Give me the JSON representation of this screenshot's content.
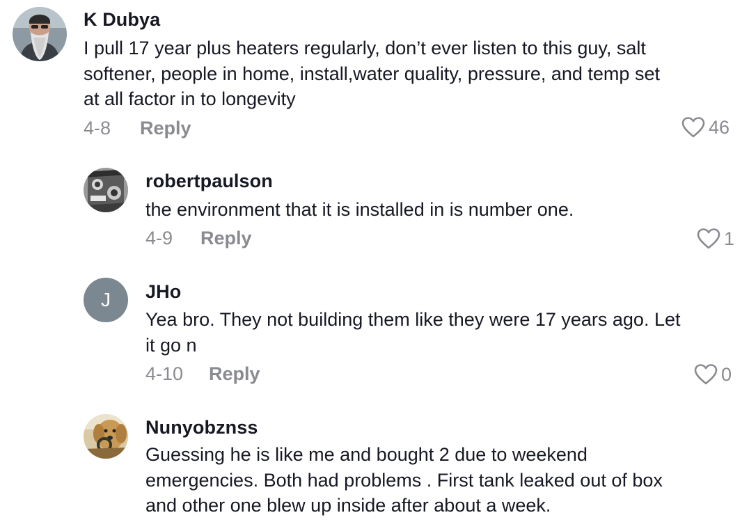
{
  "comments": [
    {
      "username": "K Dubya",
      "avatar": "photo-bearded-man",
      "text_lines": [
        "I pull 17 year plus heaters regularly, don’t ever listen to this guy, salt",
        "softener, people in home, install,water quality, pressure, and temp set",
        "at all factor in to longevity"
      ],
      "date": "4-8",
      "reply_label": "Reply",
      "likes": "46"
    },
    {
      "username": "robertpaulson",
      "avatar": "photo-engine",
      "text_lines": [
        "the environment that it is installed in is number one."
      ],
      "date": "4-9",
      "reply_label": "Reply",
      "likes": "1"
    },
    {
      "username": "JHo",
      "avatar": "letter-avatar",
      "avatar_letter": "J",
      "avatar_color": "#7b8892",
      "text_lines": [
        "Yea bro. They not building them like they were 17 years ago. Let",
        "it go n"
      ],
      "date": "4-10",
      "reply_label": "Reply",
      "likes": "0"
    },
    {
      "username": "Nunyobznss",
      "avatar": "photo-golden-dog",
      "text_lines": [
        "Guessing he is like me and bought 2 due to weekend",
        "emergencies. Both had problems . First tank leaked out of box",
        "and other one blew up inside after about a week."
      ]
    }
  ],
  "icons": {
    "like": "heart-outline-icon"
  },
  "colors": {
    "text": "#161823",
    "muted": "#8a8b91"
  }
}
